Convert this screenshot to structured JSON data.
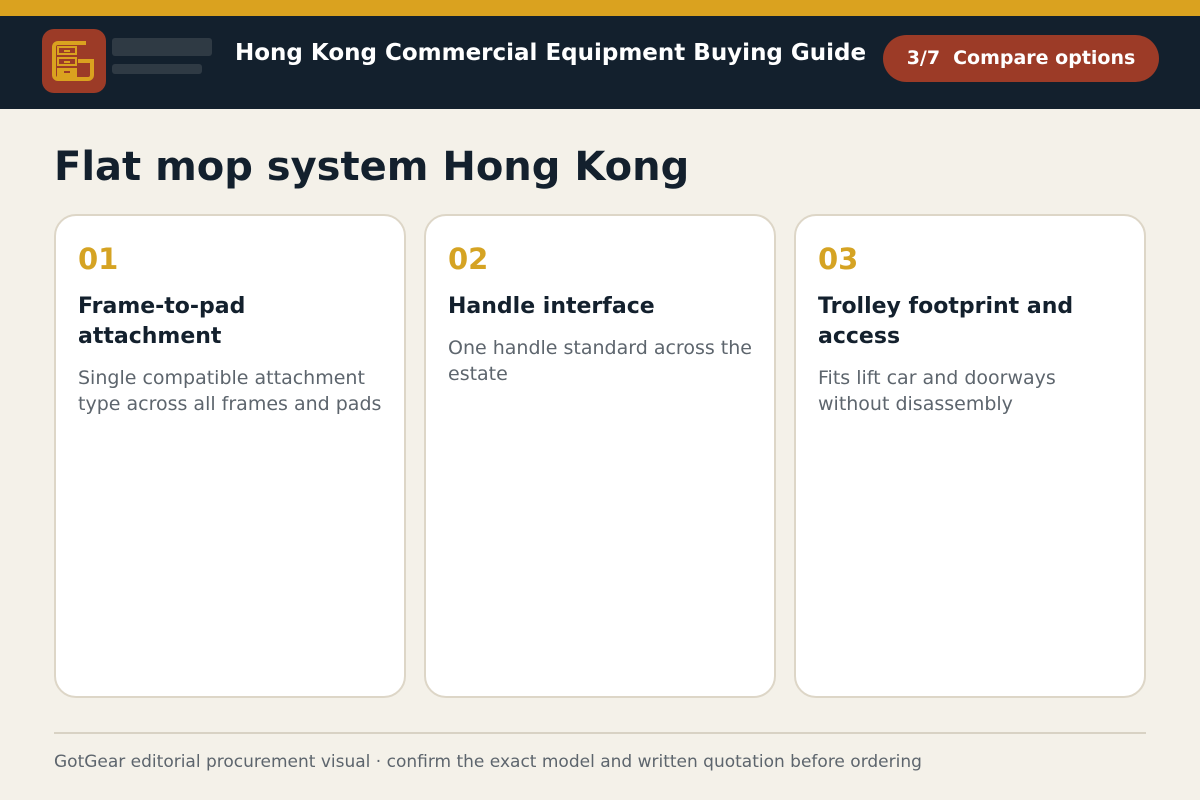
{
  "header": {
    "title": "Hong Kong Commercial Equipment Buying Guide",
    "step": "3/7",
    "action_label": "Compare options"
  },
  "page": {
    "title": "Flat mop system Hong Kong"
  },
  "cards": [
    {
      "number": "01",
      "title": "Frame-to-pad attachment",
      "description": "Single compatible attachment type across all frames and pads"
    },
    {
      "number": "02",
      "title": "Handle interface",
      "description": "One handle standard across the estate"
    },
    {
      "number": "03",
      "title": "Trolley footprint and access",
      "description": "Fits lift car and doorways without disassembly"
    }
  ],
  "footer": {
    "note": "GotGear editorial procurement visual · confirm the exact model and written quotation before ordering"
  },
  "colors": {
    "accent_gold": "#daa21f",
    "brand_red": "#9c3b27",
    "header_navy": "#13202d",
    "background": "#f4f1e9"
  }
}
